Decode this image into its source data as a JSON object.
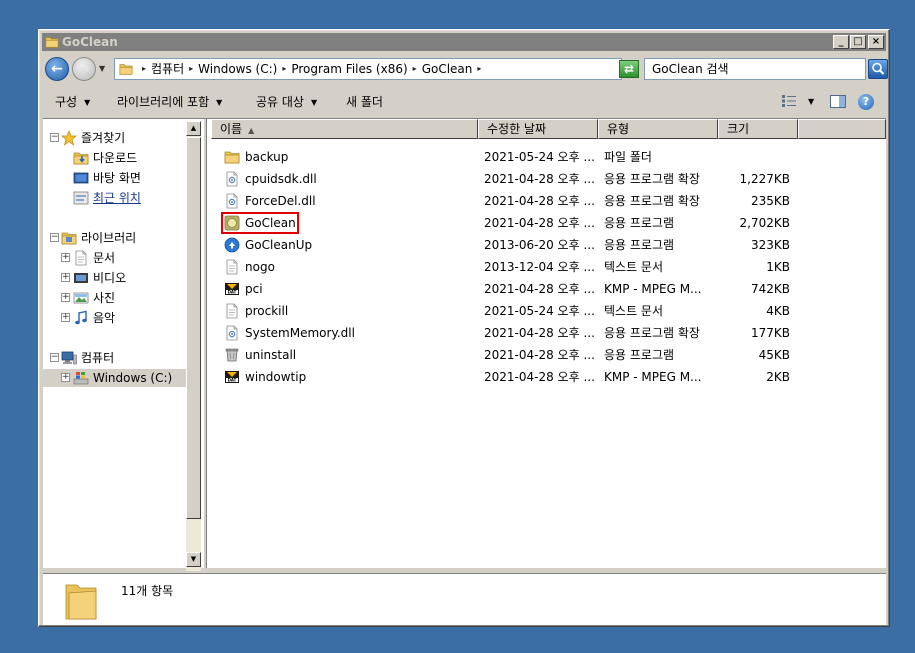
{
  "window": {
    "title": "GoClean",
    "btn_minimize": "_",
    "btn_maximize": "□",
    "btn_close": "×"
  },
  "address": {
    "crumbs": [
      "컴퓨터",
      "Windows (C:)",
      "Program Files (x86)",
      "GoClean"
    ],
    "search_placeholder": "GoClean 검색"
  },
  "toolbar": {
    "organize": "구성",
    "include_library": "라이브러리에 포함",
    "share_with": "공유 대상",
    "new_folder": "새 폴더"
  },
  "nav": {
    "favorites": "즐겨찾기",
    "downloads": "다운로드",
    "desktop": "바탕 화면",
    "recent": "최근 위치",
    "libraries": "라이브러리",
    "documents": "문서",
    "videos": "비디오",
    "pictures": "사진",
    "music": "음악",
    "computer": "컴퓨터",
    "drive_c": "Windows (C:)"
  },
  "columns": {
    "name": "이름",
    "date": "수정한 날짜",
    "type": "유형",
    "size": "크기"
  },
  "files": [
    {
      "name": "backup",
      "date": "2021-05-24 오후 ...",
      "type": "파일 폴더",
      "size": "",
      "icon": "folder-icon"
    },
    {
      "name": "cpuidsdk.dll",
      "date": "2021-04-28 오후 ...",
      "type": "응용 프로그램 확장",
      "size": "1,227KB",
      "icon": "dll-file-icon"
    },
    {
      "name": "ForceDel.dll",
      "date": "2021-04-28 오후 ...",
      "type": "응용 프로그램 확장",
      "size": "235KB",
      "icon": "dll-file-icon"
    },
    {
      "name": "GoClean",
      "date": "2021-04-28 오후 ...",
      "type": "응용 프로그램",
      "size": "2,702KB",
      "icon": "goclean-app-icon"
    },
    {
      "name": "GoCleanUp",
      "date": "2013-06-20 오후 ...",
      "type": "응용 프로그램",
      "size": "323KB",
      "icon": "gocleanup-app-icon"
    },
    {
      "name": "nogo",
      "date": "2013-12-04 오후 ...",
      "type": "텍스트 문서",
      "size": "1KB",
      "icon": "text-file-icon"
    },
    {
      "name": "pci",
      "date": "2021-04-28 오후 ...",
      "type": "KMP - MPEG M...",
      "size": "742KB",
      "icon": "dat-file-icon"
    },
    {
      "name": "prockill",
      "date": "2021-05-24 오후 ...",
      "type": "텍스트 문서",
      "size": "4KB",
      "icon": "text-file-icon"
    },
    {
      "name": "SystemMemory.dll",
      "date": "2021-04-28 오후 ...",
      "type": "응용 프로그램 확장",
      "size": "177KB",
      "icon": "dll-file-icon"
    },
    {
      "name": "uninstall",
      "date": "2021-04-28 오후 ...",
      "type": "응용 프로그램",
      "size": "45KB",
      "icon": "uninstall-app-icon"
    },
    {
      "name": "windowtip",
      "date": "2021-04-28 오후 ...",
      "type": "KMP - MPEG M...",
      "size": "2KB",
      "icon": "dat-file-icon"
    }
  ],
  "status": {
    "item_count": "11개 항목"
  },
  "colors": {
    "desktop": "#3a6ea5",
    "highlight": "#e00000",
    "folder": "#e8c25a"
  }
}
